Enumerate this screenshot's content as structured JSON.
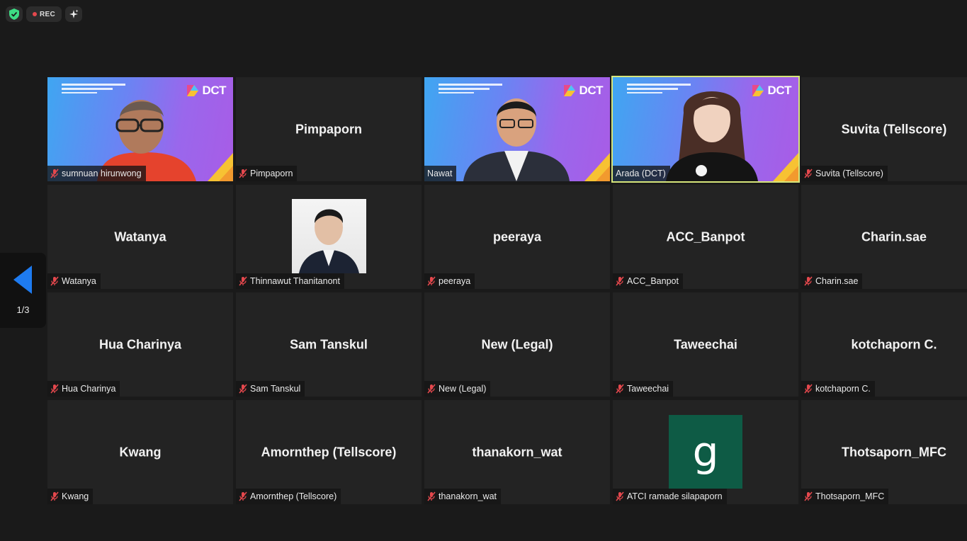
{
  "recording": {
    "label": "REC",
    "color": "#e5484d"
  },
  "pager": {
    "text": "1/3"
  },
  "brand": {
    "logo_text": "DCT"
  },
  "participants": [
    {
      "name": "sumnuan hirunwong",
      "display": "video",
      "muted": true
    },
    {
      "name": "Pimpaporn",
      "display": "name",
      "muted": true
    },
    {
      "name": "Nawat",
      "display": "video",
      "muted": false
    },
    {
      "name": "Arada (DCT)",
      "display": "video",
      "muted": false,
      "speaking": true
    },
    {
      "name": "Suvita (Tellscore)",
      "display": "name",
      "muted": true
    },
    {
      "name": "Watanya",
      "display": "name",
      "muted": true
    },
    {
      "name": "Thinnawut Thanitanont",
      "display": "photo",
      "muted": true
    },
    {
      "name": "peeraya",
      "display": "name",
      "muted": true
    },
    {
      "name": "ACC_Banpot",
      "display": "name",
      "muted": true
    },
    {
      "name": "Charin.sae",
      "display": "name",
      "muted": true
    },
    {
      "name": "Hua Charinya",
      "display": "name",
      "muted": true
    },
    {
      "name": "Sam Tanskul",
      "display": "name",
      "muted": true
    },
    {
      "name": "New (Legal)",
      "display": "name",
      "muted": true
    },
    {
      "name": "Taweechai",
      "display": "name",
      "muted": true
    },
    {
      "name": "kotchaporn C.",
      "display": "name",
      "muted": true
    },
    {
      "name": "Kwang",
      "display": "name",
      "muted": true
    },
    {
      "name": "Amornthep (Tellscore)",
      "display": "name",
      "muted": true
    },
    {
      "name": "thanakorn_wat",
      "display": "name",
      "muted": true
    },
    {
      "name": "ATCI ramade silapaporn",
      "display": "avatar",
      "avatar_letter": "g",
      "avatar_color": "#0e5b45",
      "muted": true
    },
    {
      "name": "Thotsaporn_MFC",
      "display": "name",
      "muted": true
    }
  ],
  "colors": {
    "active_speaker": "#d6e57a",
    "muted_icon": "#e5484d",
    "nav_arrow": "#1e7bf0"
  }
}
